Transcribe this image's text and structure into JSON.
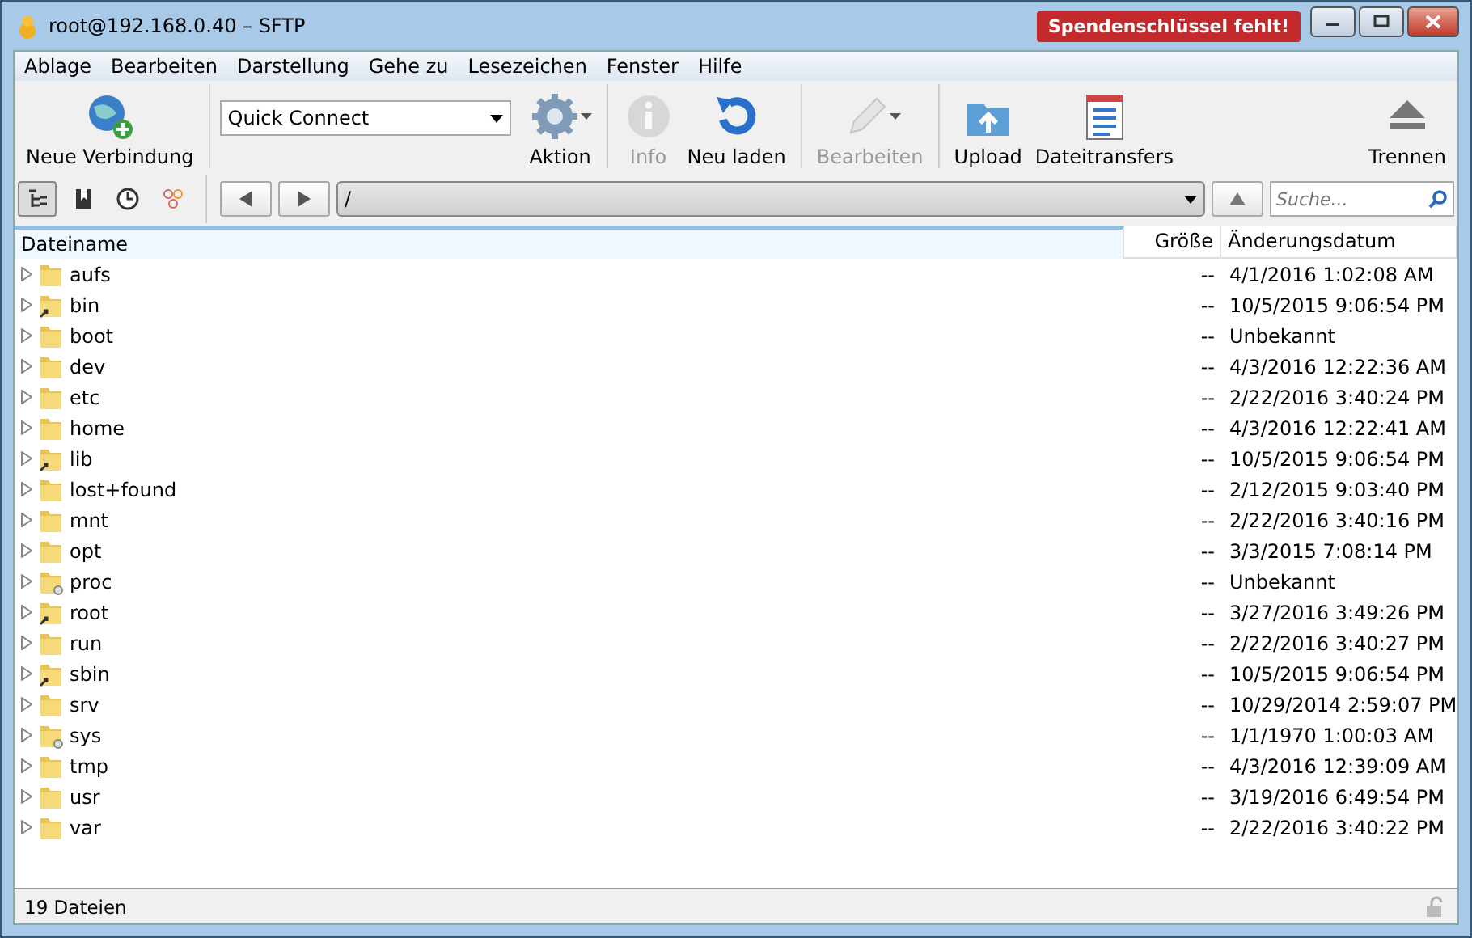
{
  "window": {
    "title": "root@192.168.0.40 – SFTP",
    "notice": "Spendenschlüssel fehlt!"
  },
  "menu": [
    "Ablage",
    "Bearbeiten",
    "Darstellung",
    "Gehe zu",
    "Lesezeichen",
    "Fenster",
    "Hilfe"
  ],
  "toolbar": {
    "quick_connect": "Quick Connect",
    "buttons": [
      {
        "label": "Neue Verbindung",
        "disabled": false,
        "menu": false
      },
      {
        "label": "Aktion",
        "disabled": false,
        "menu": true
      },
      {
        "label": "Info",
        "disabled": true,
        "menu": false
      },
      {
        "label": "Neu laden",
        "disabled": false,
        "menu": false
      },
      {
        "label": "Bearbeiten",
        "disabled": true,
        "menu": true
      },
      {
        "label": "Upload",
        "disabled": false,
        "menu": false
      },
      {
        "label": "Dateitransfers",
        "disabled": false,
        "menu": false
      },
      {
        "label": "Trennen",
        "disabled": false,
        "menu": false
      }
    ]
  },
  "view_buttons": [
    {
      "selected": true
    },
    {
      "selected": false
    },
    {
      "selected": false
    },
    {
      "selected": false
    }
  ],
  "path": "/",
  "search": {
    "placeholder": "Suche..."
  },
  "table": {
    "columns": [
      "Dateiname",
      "Größe",
      "Änderungsdatum"
    ],
    "rows": [
      {
        "name": "aufs",
        "kind": "folder",
        "size": "--",
        "date": "4/1/2016 1:02:08 AM"
      },
      {
        "name": "bin",
        "kind": "link",
        "size": "--",
        "date": "10/5/2015 9:06:54 PM"
      },
      {
        "name": "boot",
        "kind": "folder",
        "size": "--",
        "date": "Unbekannt"
      },
      {
        "name": "dev",
        "kind": "folder",
        "size": "--",
        "date": "4/3/2016 12:22:36 AM"
      },
      {
        "name": "etc",
        "kind": "folder",
        "size": "--",
        "date": "2/22/2016 3:40:24 PM"
      },
      {
        "name": "home",
        "kind": "folder",
        "size": "--",
        "date": "4/3/2016 12:22:41 AM"
      },
      {
        "name": "lib",
        "kind": "link",
        "size": "--",
        "date": "10/5/2015 9:06:54 PM"
      },
      {
        "name": "lost+found",
        "kind": "folder",
        "size": "--",
        "date": "2/12/2015 9:03:40 PM"
      },
      {
        "name": "mnt",
        "kind": "folder",
        "size": "--",
        "date": "2/22/2016 3:40:16 PM"
      },
      {
        "name": "opt",
        "kind": "folder",
        "size": "--",
        "date": "3/3/2015 7:08:14 PM"
      },
      {
        "name": "proc",
        "kind": "locked",
        "size": "--",
        "date": "Unbekannt"
      },
      {
        "name": "root",
        "kind": "link",
        "size": "--",
        "date": "3/27/2016 3:49:26 PM"
      },
      {
        "name": "run",
        "kind": "folder",
        "size": "--",
        "date": "2/22/2016 3:40:27 PM"
      },
      {
        "name": "sbin",
        "kind": "link",
        "size": "--",
        "date": "10/5/2015 9:06:54 PM"
      },
      {
        "name": "srv",
        "kind": "folder",
        "size": "--",
        "date": "10/29/2014 2:59:07 PM"
      },
      {
        "name": "sys",
        "kind": "locked",
        "size": "--",
        "date": "1/1/1970 1:00:03 AM"
      },
      {
        "name": "tmp",
        "kind": "folder",
        "size": "--",
        "date": "4/3/2016 12:39:09 AM"
      },
      {
        "name": "usr",
        "kind": "folder",
        "size": "--",
        "date": "3/19/2016 6:49:54 PM"
      },
      {
        "name": "var",
        "kind": "folder",
        "size": "--",
        "date": "2/22/2016 3:40:22 PM"
      }
    ]
  },
  "status_bar": "19 Dateien"
}
